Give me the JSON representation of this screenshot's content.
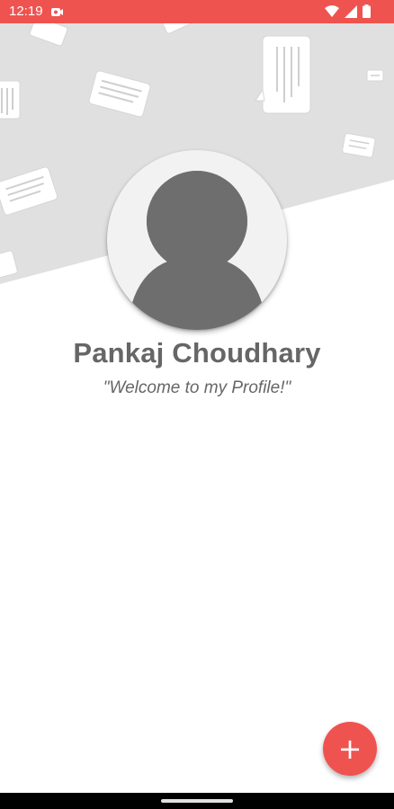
{
  "status_bar": {
    "time": "12:19",
    "notification_icon": "notification-icon",
    "icons": [
      "wifi-icon",
      "signal-icon",
      "battery-icon"
    ],
    "color": "#ef5350"
  },
  "profile": {
    "name": "Pankaj Choudhary",
    "tagline": "\"Welcome to my Profile!\"",
    "avatar_icon": "person-silhouette-icon"
  },
  "fab": {
    "label": "+",
    "icon": "add-icon",
    "color": "#ef5350"
  },
  "header": {
    "background_color": "#e0e0e0",
    "pattern_icon": "chat-bubble-icon"
  },
  "navigation_bar": {
    "handle_icon": "home-handle"
  }
}
